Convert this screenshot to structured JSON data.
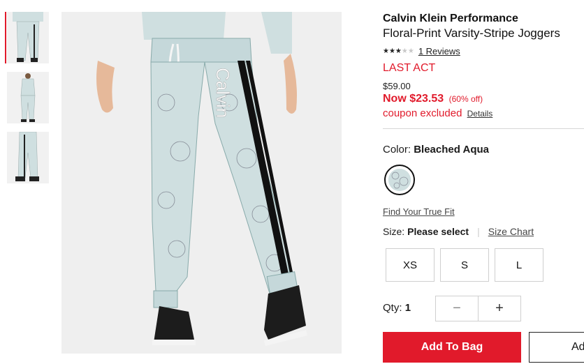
{
  "thumbnails": [
    {
      "name": "thumbnail-front-detail",
      "active": true
    },
    {
      "name": "thumbnail-full-look",
      "active": false
    },
    {
      "name": "thumbnail-side-view",
      "active": false
    }
  ],
  "product": {
    "brand": "Calvin Klein Performance",
    "name": "Floral-Print Varsity-Stripe Joggers",
    "rating_stars": "★★★★★",
    "rating_value": 3,
    "reviews_label": "1 Reviews",
    "badge": "LAST ACT",
    "original_price": "$59.00",
    "sale_price": "Now $23.53",
    "discount": "(60% off)",
    "coupon_text": "coupon excluded",
    "details_link": "Details"
  },
  "color": {
    "label": "Color:",
    "selected": "Bleached Aqua",
    "swatch_hex": "#cfdfe0"
  },
  "size": {
    "fit_link": "Find Your True Fit",
    "label": "Size:",
    "selected_text": "Please select",
    "separator": "|",
    "chart_link": "Size Chart",
    "options": [
      "XS",
      "S",
      "L"
    ]
  },
  "quantity": {
    "label": "Qty:",
    "value": "1",
    "minus": "−",
    "plus": "+"
  },
  "actions": {
    "add_to_bag": "Add To Bag",
    "add_secondary": "Ad"
  },
  "colors": {
    "accent": "#e11a2b",
    "fabric": "#cfdfe0"
  }
}
